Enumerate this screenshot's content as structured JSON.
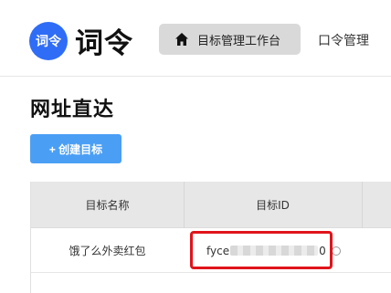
{
  "header": {
    "logo_text": "词令",
    "brand": "词令",
    "nav_active_label": "目标管理工作台",
    "nav_item_label": "口令管理"
  },
  "page": {
    "title": "网址直达",
    "create_button": "+ 创建目标"
  },
  "table": {
    "columns": [
      "目标名称",
      "目标ID"
    ],
    "rows": [
      {
        "name": "饿了么外卖红包",
        "id_prefix": "fyce",
        "id_suffix": "0"
      }
    ]
  },
  "colors": {
    "accent": "#2f6df6",
    "button": "#4a9ff5",
    "highlight": "#e0141b"
  }
}
